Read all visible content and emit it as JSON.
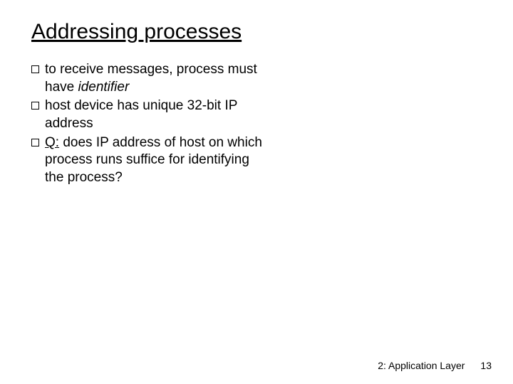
{
  "title": "Addressing processes",
  "bullets": {
    "b1_pre": "to receive messages, process  must have ",
    "b1_ital": "identifier",
    "b2": "host device has unique 32-bit IP address",
    "b3_q": "Q:",
    "b3_rest": " does  IP address of host on which process runs suffice for identifying the process?"
  },
  "footer": {
    "label": "2: Application Layer",
    "page": "13"
  }
}
